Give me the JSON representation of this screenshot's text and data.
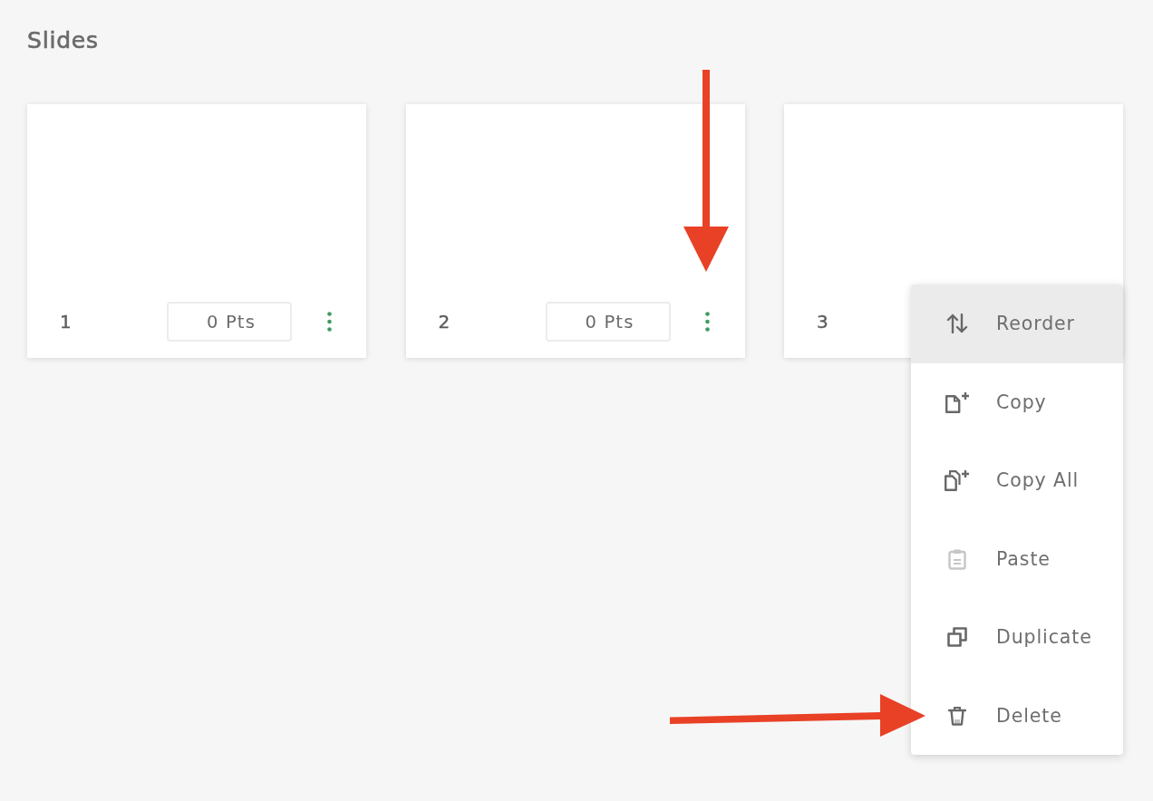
{
  "title": "Slides",
  "slides": [
    {
      "number": "1",
      "points": "0 Pts",
      "annotation_arrow": false
    },
    {
      "number": "2",
      "points": "0 Pts",
      "annotation_arrow": true
    },
    {
      "number": "3",
      "annotation_arrow": false,
      "menu": {
        "items": [
          {
            "kind": "reorder",
            "label": "Reorder",
            "selected": true,
            "disabled": false,
            "annotation_arrow": false
          },
          {
            "kind": "copy",
            "label": "Copy",
            "selected": false,
            "disabled": false,
            "annotation_arrow": false
          },
          {
            "kind": "copy-all",
            "label": "Copy All",
            "selected": false,
            "disabled": false,
            "annotation_arrow": false
          },
          {
            "kind": "paste",
            "label": "Paste",
            "selected": false,
            "disabled": true,
            "annotation_arrow": false
          },
          {
            "kind": "duplicate",
            "label": "Duplicate",
            "selected": false,
            "disabled": false,
            "annotation_arrow": false
          },
          {
            "kind": "delete",
            "label": "Delete",
            "selected": false,
            "disabled": false,
            "annotation_arrow": true
          }
        ]
      }
    }
  ]
}
